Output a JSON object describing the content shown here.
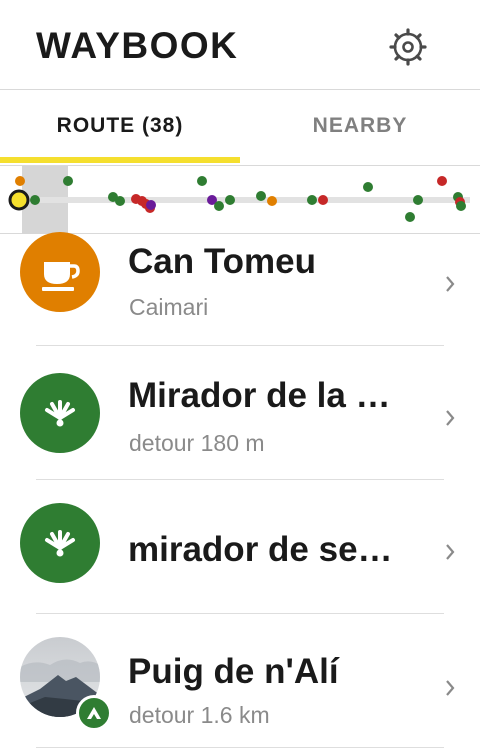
{
  "app": {
    "title": "WAYBOOK"
  },
  "tabs": [
    {
      "label": "ROUTE (38)",
      "active": true
    },
    {
      "label": "NEARBY",
      "active": false
    }
  ],
  "colors": {
    "accent": "#f5df2e",
    "cafe": "#e07f00",
    "viewpoint": "#2f7d32",
    "marker_red": "#c62828",
    "marker_purple": "#6a1b9a",
    "marker_green": "#2f7d32",
    "marker_orange": "#e07f00"
  },
  "pois": [
    {
      "name": "Can Tomeu",
      "subtitle": "Caimari",
      "icon": "coffee-cup-icon"
    },
    {
      "name": "Mirador de la …",
      "subtitle": "detour 180 m",
      "icon": "viewpoint-icon"
    },
    {
      "name": "mirador de se…",
      "subtitle": "",
      "icon": "viewpoint-icon"
    },
    {
      "name": "Puig de n'Alí",
      "subtitle": "detour 1.6 km",
      "icon": "mountain-icon"
    }
  ]
}
